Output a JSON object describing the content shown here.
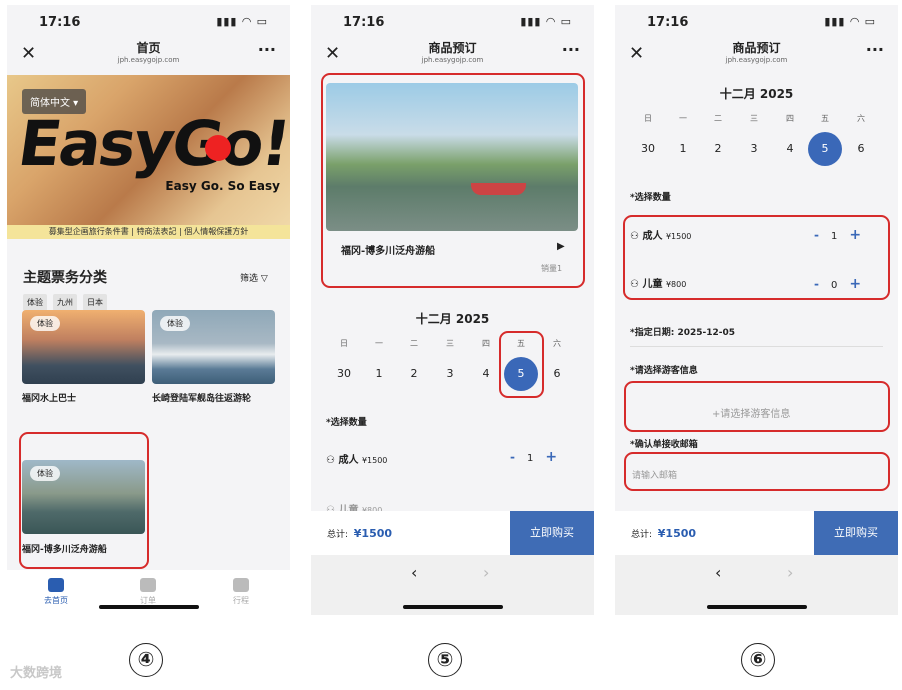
{
  "screens": [
    {
      "status_time": "17:16",
      "nav_title": "首页",
      "nav_url": "jph.easygojp.com",
      "lang": "简体中文 ▾",
      "logo": "EasyGo!",
      "slogan": "Easy Go. So Easy",
      "strip": "募集型企画旅行条件書 | 特商法表記 | 個人情報保護方針",
      "section_title": "主题票务分类",
      "filter": "筛选 ▽",
      "chips": [
        "体验",
        "九州",
        "日本"
      ],
      "cards": [
        {
          "tag": "体验",
          "caption": "福冈水上巴士"
        },
        {
          "tag": "体验",
          "caption": "长崎登陆军舰岛往返游轮"
        },
        {
          "tag": "体验",
          "caption": "福冈-博多川泛舟游船"
        }
      ],
      "tabs": [
        {
          "label": "去首页"
        },
        {
          "label": "订单"
        },
        {
          "label": "行程"
        }
      ],
      "step": "④"
    },
    {
      "status_time": "17:16",
      "nav_title": "商品预订",
      "nav_url": "jph.easygojp.com",
      "product_name": "福冈-博多川泛舟游船",
      "sales": "销量1",
      "month": "十二月 2025",
      "weekdays": [
        "日",
        "一",
        "二",
        "三",
        "四",
        "五",
        "六"
      ],
      "dates": [
        "30",
        "1",
        "2",
        "3",
        "4",
        "5",
        "6"
      ],
      "selected_date": "5",
      "qty_title": "*选择数量",
      "adult_label": "成人",
      "adult_price": "¥1500",
      "adult_qty": "1",
      "child_label": "儿童",
      "child_price": "¥800",
      "total_label": "总计:",
      "total_value": "¥1500",
      "buy_button": "立即购买",
      "step": "⑤"
    },
    {
      "status_time": "17:16",
      "nav_title": "商品预订",
      "nav_url": "jph.easygojp.com",
      "month": "十二月 2025",
      "weekdays": [
        "日",
        "一",
        "二",
        "三",
        "四",
        "五",
        "六"
      ],
      "dates": [
        "30",
        "1",
        "2",
        "3",
        "4",
        "5",
        "6"
      ],
      "selected_date": "5",
      "qty_title": "*选择数量",
      "adult_label": "成人",
      "adult_price": "¥1500",
      "adult_qty": "1",
      "child_label": "儿童",
      "child_price": "¥800",
      "child_qty": "0",
      "date_label": "*指定日期: 2025-12-05",
      "traveler_title": "*请选择游客信息",
      "traveler_placeholder": "+请选择游客信息",
      "email_title": "*确认单接收邮箱",
      "email_placeholder": "请输入邮箱",
      "total_label": "总计:",
      "total_value": "¥1500",
      "buy_button": "立即购买",
      "step": "⑥"
    }
  ],
  "watermark": "大数跨境",
  "accent_color": "#3a68b8",
  "highlight_color": "#d62b2b"
}
